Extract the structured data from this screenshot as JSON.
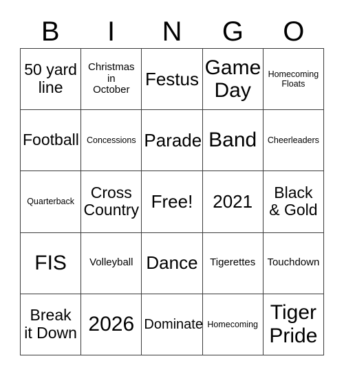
{
  "header": {
    "letters": [
      "B",
      "I",
      "N",
      "G",
      "O"
    ]
  },
  "grid": {
    "rows": 5,
    "columns": 5,
    "border_color": "#3a3a3a",
    "background_color": "#ffffff",
    "text_color": "#000000",
    "cells": [
      {
        "text": "50 yard\nline",
        "size": "lg"
      },
      {
        "text": "Christmas\nin\nOctober",
        "size": "sm"
      },
      {
        "text": "Festus",
        "size": "xl"
      },
      {
        "text": "Game\nDay",
        "size": "xxl"
      },
      {
        "text": "Homecoming\nFloats",
        "size": "xs"
      },
      {
        "text": "Football",
        "size": "lg"
      },
      {
        "text": "Concessions",
        "size": "xs"
      },
      {
        "text": "Parade",
        "size": "xl"
      },
      {
        "text": "Band",
        "size": "xxl"
      },
      {
        "text": "Cheerleaders",
        "size": "xs"
      },
      {
        "text": "Quarterback",
        "size": "xs"
      },
      {
        "text": "Cross\nCountry",
        "size": "lg"
      },
      {
        "text": "Free!",
        "size": "xl"
      },
      {
        "text": "2021",
        "size": "xl"
      },
      {
        "text": "Black\n& Gold",
        "size": "lg"
      },
      {
        "text": "FIS",
        "size": "xxl"
      },
      {
        "text": "Volleyball",
        "size": "sm"
      },
      {
        "text": "Dance",
        "size": "xl"
      },
      {
        "text": "Tigerettes",
        "size": "sm"
      },
      {
        "text": "Touchdown",
        "size": "sm"
      },
      {
        "text": "Break\nit Down",
        "size": "lg"
      },
      {
        "text": "2026",
        "size": "xxl"
      },
      {
        "text": "Dominate",
        "size": "md"
      },
      {
        "text": "Homecoming",
        "size": "xs"
      },
      {
        "text": "Tiger\nPride",
        "size": "xxl"
      }
    ]
  }
}
